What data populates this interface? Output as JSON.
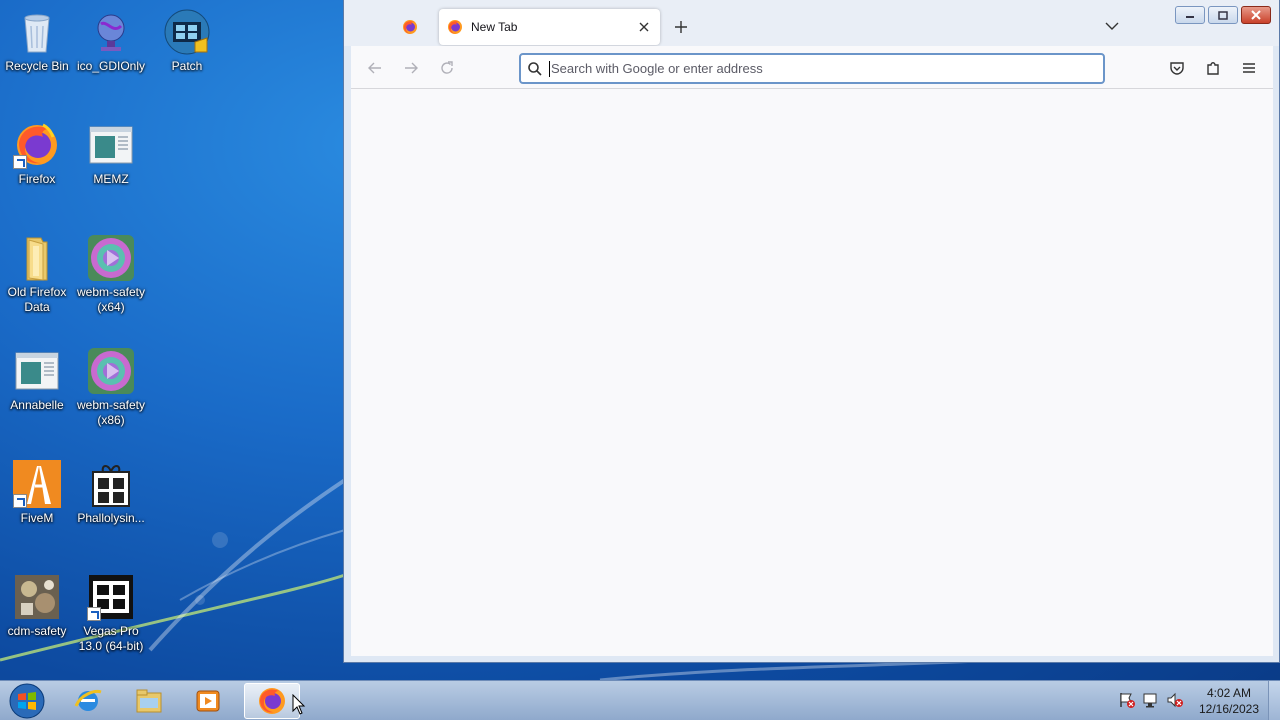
{
  "desktop": {
    "icons": [
      {
        "label": "Recycle Bin",
        "icon": "recycle-bin-icon"
      },
      {
        "label": "ico_GDIOnly",
        "icon": "globe-icon"
      },
      {
        "label": "Patch",
        "icon": "film-icon"
      },
      {
        "label": "Firefox",
        "icon": "firefox-icon"
      },
      {
        "label": "MEMZ",
        "icon": "window-app-icon"
      },
      {
        "label": "Old Firefox Data",
        "icon": "folder-icon"
      },
      {
        "label": "webm-safety (x64)",
        "icon": "media-disc-icon"
      },
      {
        "label": "Annabelle",
        "icon": "window-app-icon"
      },
      {
        "label": "webm-safety (x86)",
        "icon": "media-disc-icon"
      },
      {
        "label": "FiveM",
        "icon": "fivem-icon"
      },
      {
        "label": "Phallolysin...",
        "icon": "gift-icon"
      },
      {
        "label": "cdm-safety",
        "icon": "photo-icon"
      },
      {
        "label": "Vegas Pro 13.0 (64-bit)",
        "icon": "film-icon"
      }
    ]
  },
  "browser": {
    "tabs": [
      {
        "label": "",
        "icon": "firefox-icon",
        "pinned": true
      },
      {
        "label": "New Tab",
        "icon": "firefox-icon",
        "active": true
      }
    ],
    "urlbar": {
      "placeholder": "Search with Google or enter address",
      "value": ""
    },
    "colors": {
      "accent": "#0060df",
      "urlbar_border": "#6b95c9",
      "content_bg": "#f9f9fb"
    }
  },
  "taskbar": {
    "apps": [
      {
        "icon": "internet-explorer-icon"
      },
      {
        "icon": "file-explorer-icon"
      },
      {
        "icon": "media-player-icon"
      },
      {
        "icon": "firefox-icon",
        "active": true
      }
    ],
    "tray": [
      "action-center-icon",
      "network-icon",
      "volume-muted-icon"
    ],
    "clock": {
      "time": "4:02 AM",
      "date": "12/16/2023"
    }
  }
}
